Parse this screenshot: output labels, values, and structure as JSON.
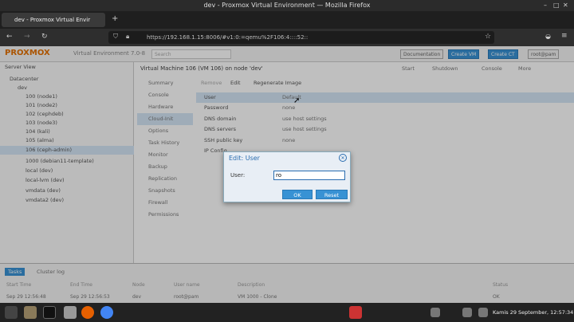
{
  "window": {
    "title": "dev - Proxmox Virtual Environment — Mozilla Firefox"
  },
  "tabs": [
    {
      "label": "dev - Proxmox Virtual Envir"
    }
  ],
  "url": "https://192.168.1.15:8006/#v1:0:=qemu%2F106:4::::52::",
  "pve": {
    "version": "Virtual Environment 7.0-8",
    "search": "Search",
    "docs": "Documentation",
    "create_vm": "Create VM",
    "create_ct": "Create CT",
    "user": "root@pam",
    "server_view": "Server View",
    "vm_title": "Virtual Machine 106 (VM 106) on node 'dev'",
    "actions": {
      "start": "Start",
      "shutdown": "Shutdown",
      "console": "Console",
      "more": "More"
    }
  },
  "tree": [
    {
      "label": "Datacenter"
    },
    {
      "label": "dev"
    },
    {
      "label": "100 (node1)"
    },
    {
      "label": "101 (node2)"
    },
    {
      "label": "102 (cephdeb)"
    },
    {
      "label": "103 (node3)"
    },
    {
      "label": "104 (kali)"
    },
    {
      "label": "105 (alma)"
    },
    {
      "label": "106 (ceph-admin)"
    },
    {
      "label": "1000 (debian11-template)"
    },
    {
      "label": "local (dev)"
    },
    {
      "label": "local-lvm (dev)"
    },
    {
      "label": "vmdata (dev)"
    },
    {
      "label": "vmdata2 (dev)"
    }
  ],
  "menu": [
    "Summary",
    "Console",
    "Hardware",
    "Cloud-Init",
    "Options",
    "Task History",
    "Monitor",
    "Backup",
    "Replication",
    "Snapshots",
    "Firewall",
    "Permissions"
  ],
  "toolbar": {
    "remove": "Remove",
    "edit": "Edit",
    "regen": "Regenerate Image"
  },
  "cloudinit": [
    {
      "key": "User",
      "value": "Default"
    },
    {
      "key": "Password",
      "value": "none"
    },
    {
      "key": "DNS domain",
      "value": "use host settings"
    },
    {
      "key": "DNS servers",
      "value": "use host settings"
    },
    {
      "key": "SSH public key",
      "value": "none"
    },
    {
      "key": "IP Config",
      "value": ""
    }
  ],
  "dialog": {
    "title": "Edit: User",
    "label": "User:",
    "value": "ro",
    "ok": "OK",
    "reset": "Reset"
  },
  "bottom": {
    "tabs": [
      "Tasks",
      "Cluster log"
    ],
    "headers": [
      "Start Time",
      "End Time",
      "Node",
      "User name",
      "Description",
      "Status"
    ],
    "row": [
      "Sep 29 12:56:48",
      "Sep 29 12:56:53",
      "dev",
      "root@pam",
      "VM 1000 - Clone",
      "OK"
    ]
  },
  "taskbar": {
    "clock": "Kamis 29 September, 12:57:34"
  }
}
